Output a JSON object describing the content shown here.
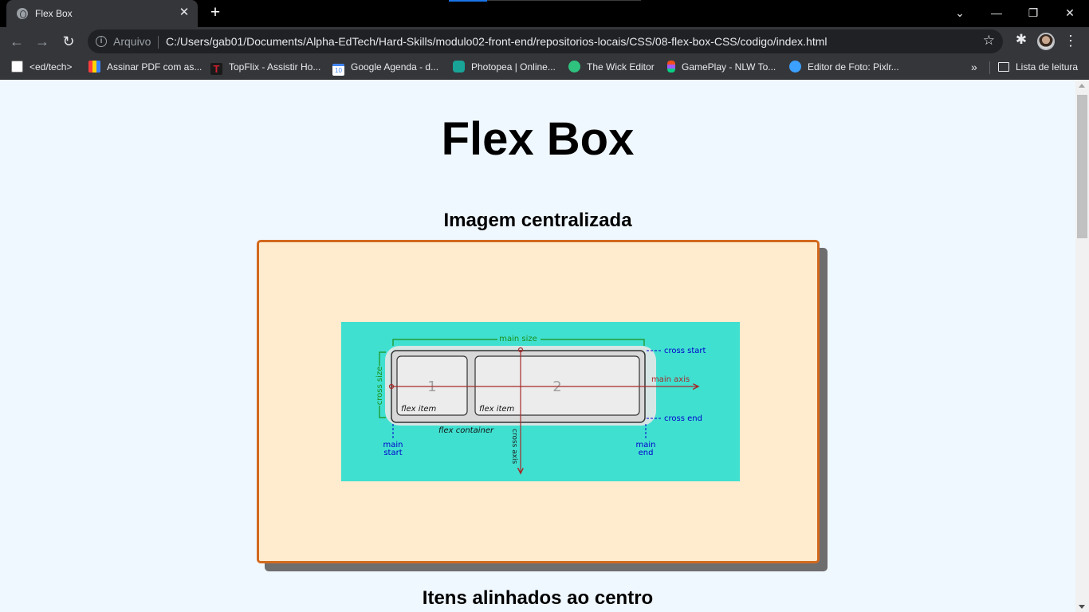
{
  "browser": {
    "tab_title": "Flex Box",
    "tab_close": "✕",
    "new_tab": "+",
    "window_controls": {
      "dropdown": "⌄",
      "minimize": "—",
      "restore": "❐",
      "close": "✕"
    },
    "nav": {
      "back": "←",
      "forward": "→",
      "reload": "↻"
    },
    "address_scheme": "Arquivo",
    "address_url": "C:/Users/gab01/Documents/Alpha-EdTech/Hard-Skills/modulo02-front-end/repositorios-locais/CSS/08-flex-box-CSS/codigo/index.html",
    "star": "☆",
    "extensions": "✱",
    "menu": "⋮"
  },
  "bookmarks": [
    {
      "label": "<ed/tech>",
      "icon": "edtech-icon",
      "color": "#ffffff"
    },
    {
      "label": "Assinar PDF com as...",
      "icon": "colorful-grid-icon",
      "color": "#ff5a36"
    },
    {
      "label": "TopFlix - Assistir Ho...",
      "icon": "topflix-icon",
      "color": "#d01f2f"
    },
    {
      "label": "Google Agenda - d...",
      "icon": "calendar-icon",
      "color": "#4285f4"
    },
    {
      "label": "Photopea | Online...",
      "icon": "photopea-icon",
      "color": "#18a497"
    },
    {
      "label": "The Wick Editor",
      "icon": "wick-icon",
      "color": "#2ec27e"
    },
    {
      "label": "GamePlay - NLW To...",
      "icon": "figma-icon",
      "color": "#f24e1e"
    },
    {
      "label": "Editor de Foto: Pixlr...",
      "icon": "pixlr-icon",
      "color": "#3ba0ff"
    }
  ],
  "bookmarks_more": "»",
  "reading_list": "Lista de leitura",
  "page": {
    "title": "Flex Box",
    "section1_title": "Imagem centralizada",
    "section2_title": "Itens alinhados ao centro"
  },
  "diagram": {
    "main_size": "main size",
    "cross_start": "cross start",
    "cross_end": "cross end",
    "main_axis": "main axis",
    "cross_size": "cross size",
    "cross_axis": "cross axis",
    "item1_number": "1",
    "item2_number": "2",
    "item_label": "flex item",
    "container_label": "flex container",
    "main_start": [
      "main",
      "start"
    ],
    "main_end": [
      "main",
      "end"
    ]
  },
  "colors": {
    "page_bg": "#f0f8ff",
    "box_bg": "#ffebcd",
    "box_border": "#d2691e",
    "figure_bg": "#40e0d0"
  }
}
